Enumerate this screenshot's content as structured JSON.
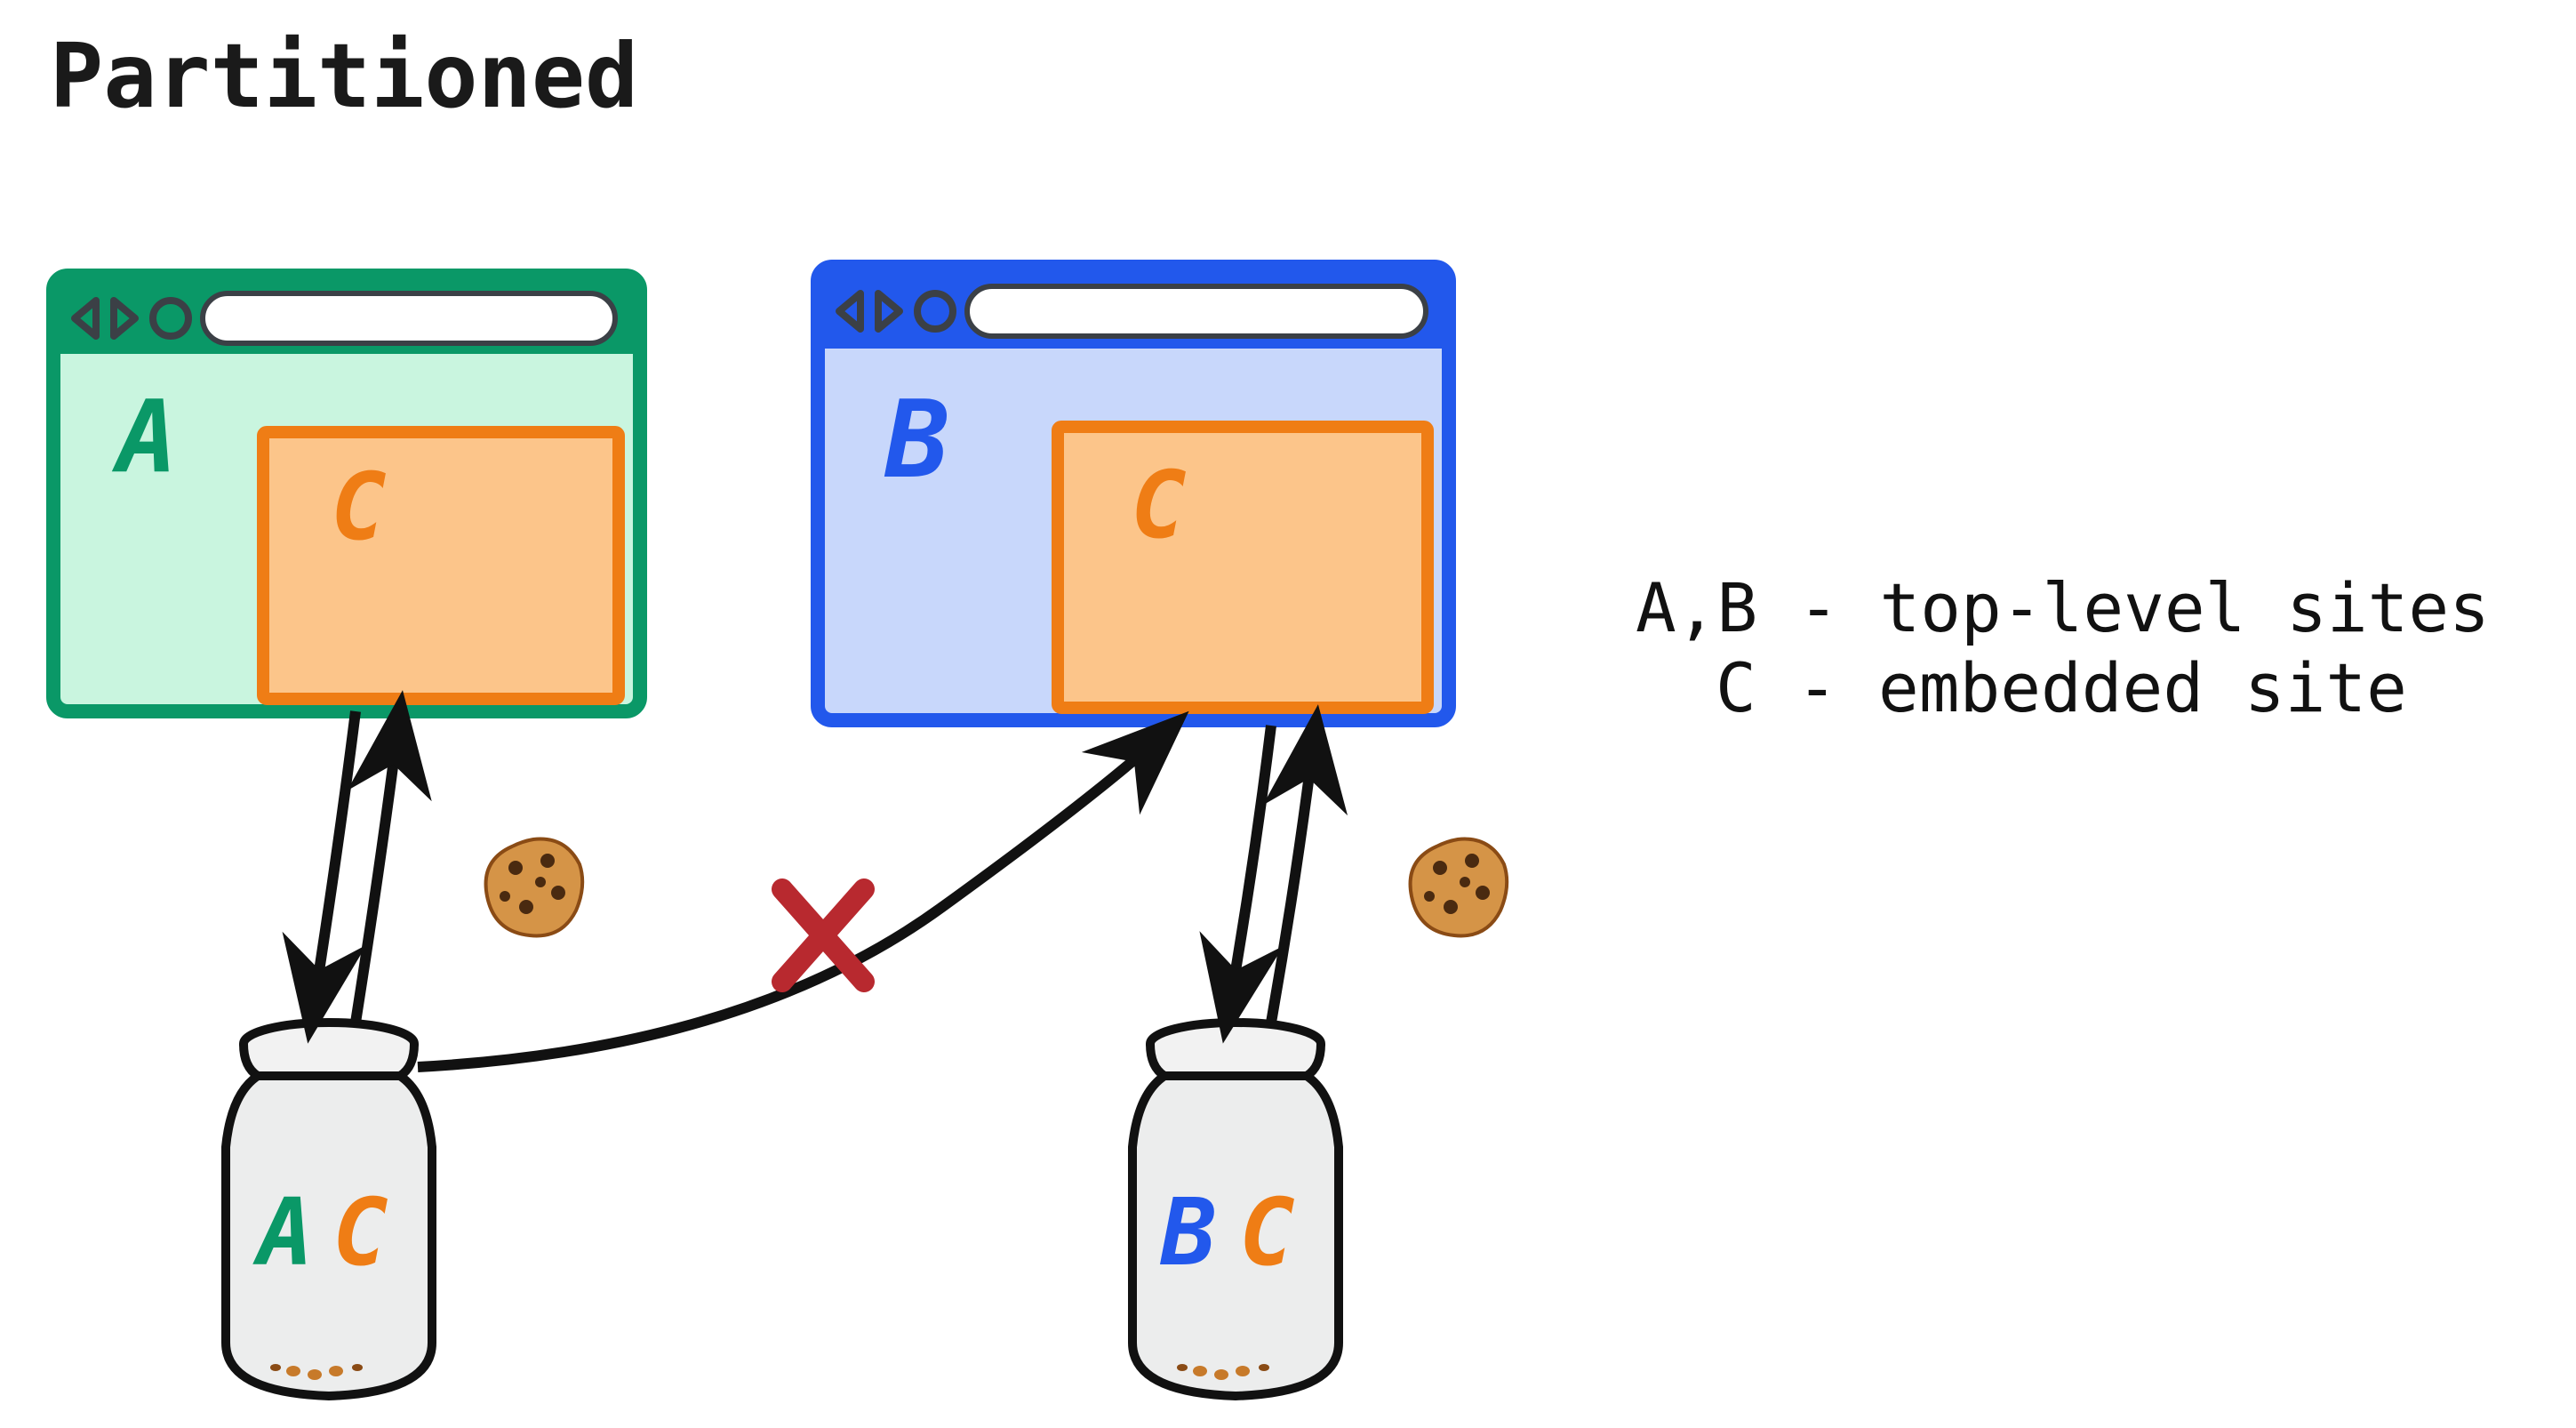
{
  "title": "Partitioned",
  "legend_line1": "A,B - top-level sites",
  "legend_line2": "C - embedded site",
  "browserA": {
    "label": "A",
    "embed": "C",
    "color": "#0a9867",
    "fill": "#c9f5df"
  },
  "browserB": {
    "label": "B",
    "embed": "C",
    "color": "#2258ec",
    "fill": "#c8d7fb"
  },
  "embed": {
    "color": "#ef7d15",
    "fill": "#fcc58a"
  },
  "jar1": {
    "label1": "A",
    "label2": "C"
  },
  "jar2": {
    "label1": "B",
    "label2": "C"
  },
  "cross_blocked_symbol": "X"
}
